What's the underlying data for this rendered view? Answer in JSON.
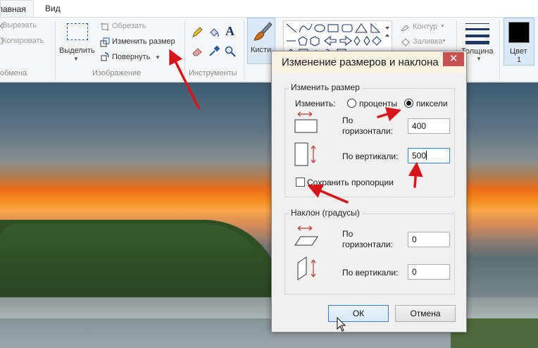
{
  "tabs": {
    "home": "лавная",
    "view": "Вид"
  },
  "clipboard": {
    "cut": "Вырезать",
    "copy": "Копировать",
    "group": "обмена"
  },
  "image": {
    "select": "Выделить",
    "crop": "Обрезать",
    "resize": "Изменить размер",
    "rotate": "Повернуть",
    "group": "Изображение"
  },
  "tools": {
    "group": "Инструменты"
  },
  "brushes": {
    "label": "Кисти"
  },
  "shapes": {
    "outline": "Контур",
    "fill": "Заливка"
  },
  "size": {
    "label": "Толщина"
  },
  "color1": {
    "label": "Цвет",
    "number": "1",
    "value": "#000000"
  },
  "dialog": {
    "title": "Изменение размеров и наклона",
    "close": "✕",
    "resize_group": "Изменить размер",
    "by_label": "Изменить:",
    "percent": "проценты",
    "pixels": "пиксели",
    "selected_unit": "пиксели",
    "horizontal_l1": "По",
    "horizontal_l2": "горизонтали:",
    "horizontal_value": "400",
    "vertical": "По вертикали:",
    "vertical_value": "500",
    "keep_ratio": "Сохранить пропорции",
    "keep_ratio_checked": false,
    "skew_group": "Наклон (градусы)",
    "skew_h_l1": "По",
    "skew_h_l2": "горизонтали:",
    "skew_h_value": "0",
    "skew_v": "По вертикали:",
    "skew_v_value": "0",
    "ok": "ОК",
    "cancel": "Отмена"
  },
  "annotations": {
    "arrow_color": "#d9141b"
  },
  "icons": [
    "cut-icon",
    "copy-icon",
    "select-icon",
    "crop-icon",
    "resize-icon",
    "rotate-icon",
    "pencil-icon",
    "fill-bucket-icon",
    "text-icon",
    "eraser-icon",
    "color-picker-icon",
    "magnifier-icon",
    "brush-icon",
    "shapes-gallery",
    "outline-icon",
    "fill-icon",
    "thickness-icon",
    "color-swatch"
  ]
}
